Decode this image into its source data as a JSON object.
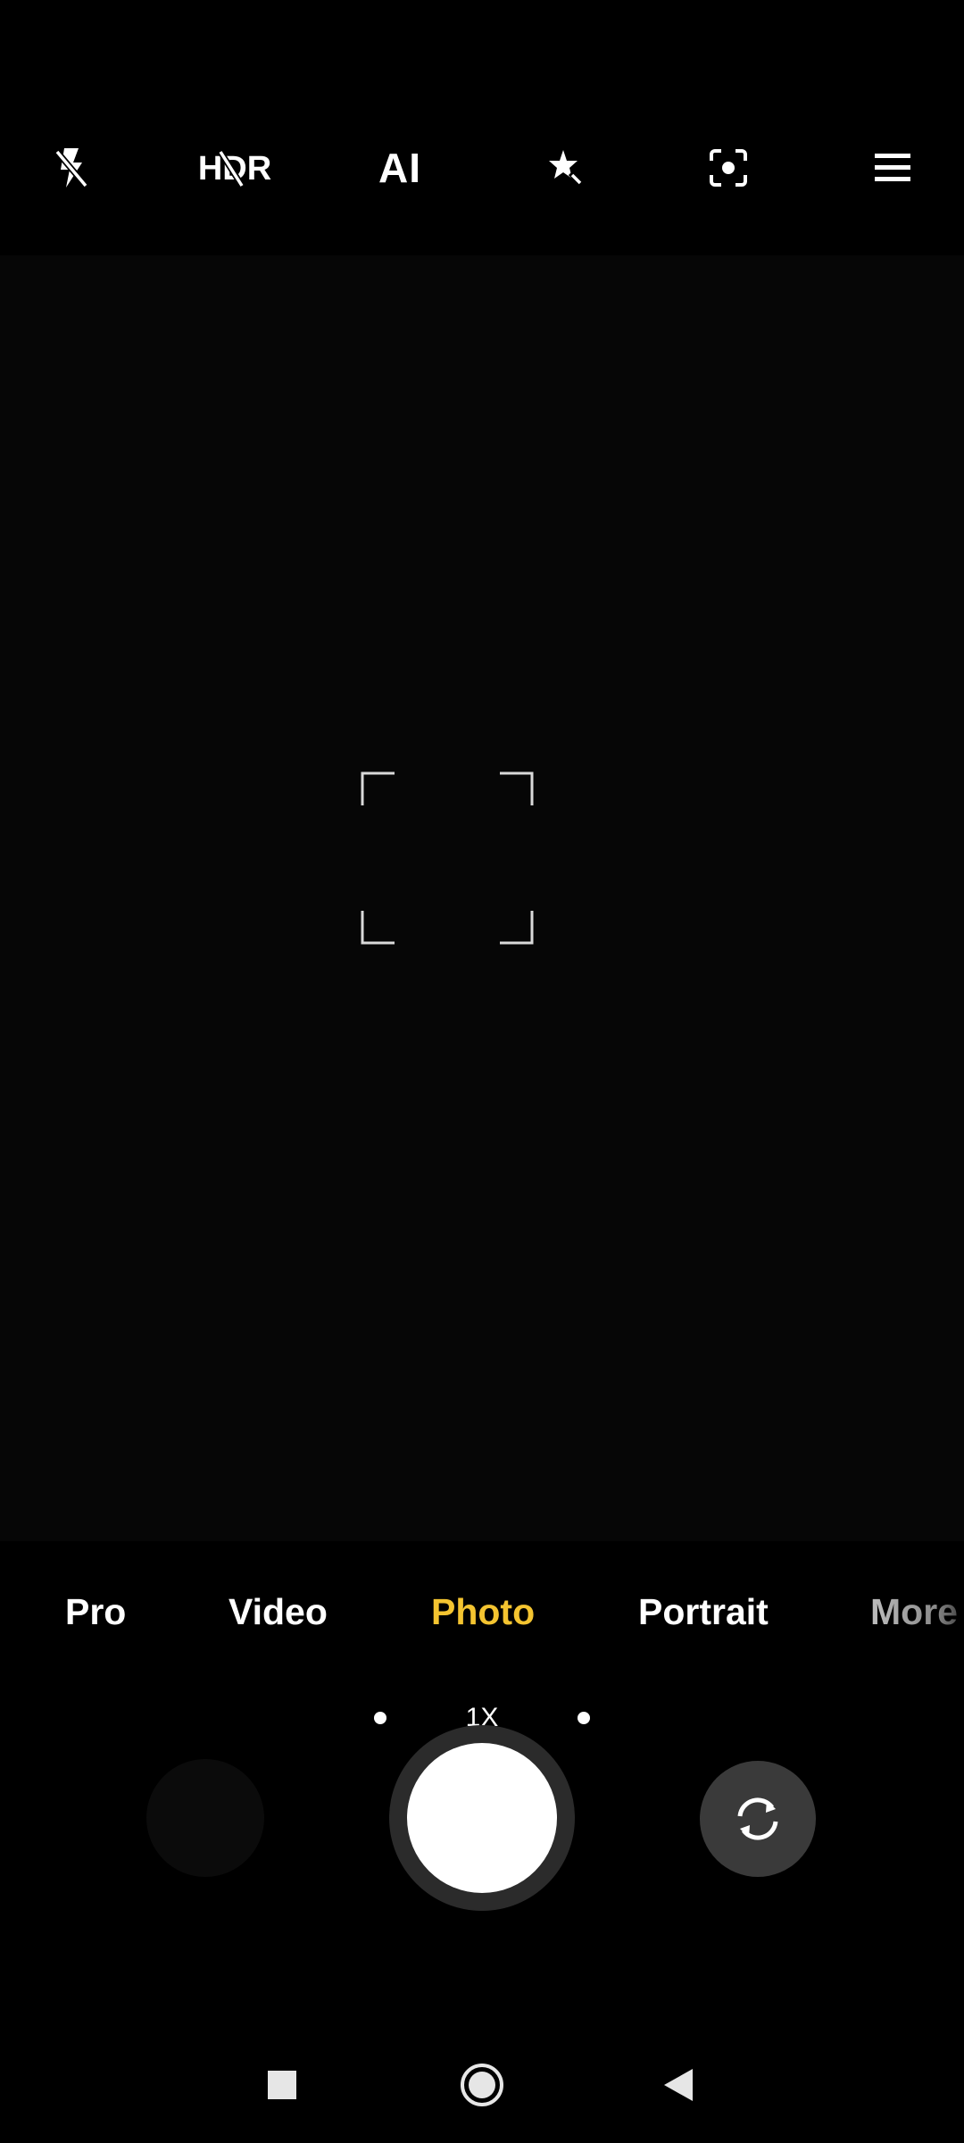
{
  "top_toolbar": {
    "flash_icon": "flash-off-icon",
    "hdr_icon": "hdr-off-icon",
    "ai_label": "AI",
    "beauty_icon": "beauty-sparkle-icon",
    "lens_icon": "google-lens-icon",
    "menu_icon": "menu-icon"
  },
  "viewfinder": {
    "focus_icon": "focus-frame-icon",
    "zoom_label": "1X"
  },
  "modes": [
    {
      "label": "Pro",
      "active": false
    },
    {
      "label": "Video",
      "active": false
    },
    {
      "label": "Photo",
      "active": true
    },
    {
      "label": "Portrait",
      "active": false
    },
    {
      "label": "More",
      "active": false
    }
  ],
  "colors": {
    "active_mode": "#f4c430",
    "background": "#000000",
    "viewfinder": "#060606"
  },
  "controls": {
    "shutter_icon": "shutter-button",
    "switch_icon": "switch-camera-icon",
    "gallery": "gallery-thumbnail"
  },
  "nav_bar": {
    "recents_icon": "square-icon",
    "home_icon": "circle-icon",
    "back_icon": "triangle-back-icon"
  }
}
